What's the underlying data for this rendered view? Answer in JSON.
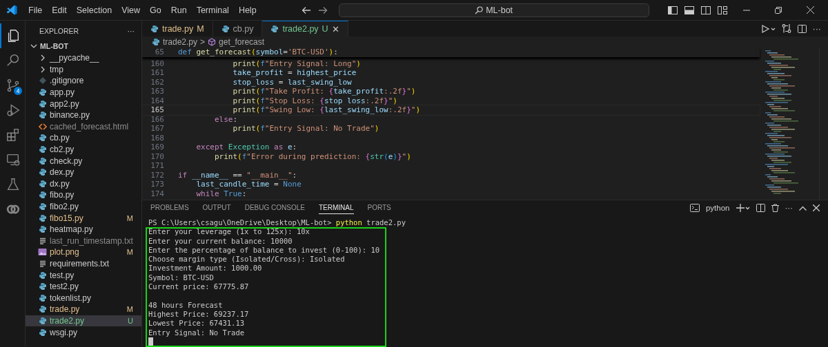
{
  "menu": [
    "File",
    "Edit",
    "Selection",
    "View",
    "Go",
    "Run",
    "Terminal",
    "Help"
  ],
  "command_center": {
    "text": "ML-bot"
  },
  "activity_bar": [
    {
      "kind": "explorer",
      "selected": true
    },
    {
      "kind": "search",
      "selected": false
    },
    {
      "kind": "source-control",
      "selected": false,
      "badge": "4"
    },
    {
      "kind": "run",
      "selected": false
    },
    {
      "kind": "extensions",
      "selected": false
    },
    {
      "kind": "remote",
      "selected": false
    },
    {
      "kind": "testing",
      "selected": false
    },
    {
      "kind": "copilot",
      "selected": false
    }
  ],
  "explorer": {
    "title": "EXPLORER",
    "more": "···",
    "folder": {
      "name": "ML-BOT",
      "expanded": true
    },
    "items": [
      {
        "name": "__pycache__",
        "kind": "folder",
        "expanded": false,
        "selected": false
      },
      {
        "name": "tmp",
        "kind": "folder",
        "expanded": false,
        "selected": false
      },
      {
        "name": ".gitignore",
        "kind": "ignore",
        "selected": false
      },
      {
        "name": "app.py",
        "kind": "python",
        "selected": false
      },
      {
        "name": "app2.py",
        "kind": "python",
        "selected": false
      },
      {
        "name": "binance.py",
        "kind": "python",
        "selected": false
      },
      {
        "name": "cached_forecast.html",
        "kind": "html",
        "ignored": true,
        "selected": false
      },
      {
        "name": "cb.py",
        "kind": "python",
        "selected": false
      },
      {
        "name": "cb2.py",
        "kind": "python",
        "selected": false
      },
      {
        "name": "check.py",
        "kind": "python",
        "selected": false
      },
      {
        "name": "dex.py",
        "kind": "python",
        "selected": false
      },
      {
        "name": "dx.py",
        "kind": "python",
        "selected": false
      },
      {
        "name": "fibo.py",
        "kind": "python",
        "selected": false
      },
      {
        "name": "fibo2.py",
        "kind": "python",
        "selected": false
      },
      {
        "name": "fibo15.py",
        "kind": "python",
        "status": "M",
        "selected": false
      },
      {
        "name": "heatmap.py",
        "kind": "python",
        "selected": false
      },
      {
        "name": "last_run_timestamp.txt",
        "kind": "text",
        "ignored": true,
        "selected": false
      },
      {
        "name": "plot.png",
        "kind": "image",
        "status": "M",
        "selected": false
      },
      {
        "name": "requirements.txt",
        "kind": "text",
        "selected": false
      },
      {
        "name": "test.py",
        "kind": "python",
        "selected": false
      },
      {
        "name": "test2.py",
        "kind": "python",
        "selected": false
      },
      {
        "name": "tokenlist.py",
        "kind": "python",
        "selected": false
      },
      {
        "name": "trade.py",
        "kind": "python",
        "status": "M",
        "selected": false
      },
      {
        "name": "trade2.py",
        "kind": "python",
        "status": "U",
        "selected": true
      },
      {
        "name": "wsgi.py",
        "kind": "python",
        "selected": false
      }
    ]
  },
  "tabs": [
    {
      "label": "trade.py",
      "status": "M",
      "selected": false
    },
    {
      "label": "cb.py",
      "selected": false
    },
    {
      "label": "trade2.py",
      "status": "U",
      "selected": true,
      "close": "✕"
    }
  ],
  "editor_actions": {
    "more": "···"
  },
  "breadcrumb": {
    "file": "trade2.py",
    "separator": ">",
    "symbol": "get_forecast"
  },
  "sticky_line": {
    "number": "65",
    "tokens": [
      {
        "kind": "storage",
        "text": "def "
      },
      {
        "kind": "fn",
        "text": "get_forecast"
      },
      {
        "kind": "brace1",
        "text": "("
      },
      {
        "kind": "var",
        "text": "symbol"
      },
      {
        "kind": "op",
        "text": "="
      },
      {
        "kind": "str",
        "text": "'BTC-USD'"
      },
      {
        "kind": "brace1",
        "text": ")"
      },
      {
        "kind": "plain",
        "text": ":"
      }
    ]
  },
  "code_lines": [
    {
      "number": "160",
      "current": false,
      "tokens": [
        {
          "kind": "fn",
          "text": "            print"
        },
        {
          "kind": "brace1",
          "text": "("
        },
        {
          "kind": "storage",
          "text": "f"
        },
        {
          "kind": "str",
          "text": "\"Entry Signal: Long\""
        },
        {
          "kind": "brace1",
          "text": ")"
        }
      ]
    },
    {
      "number": "161",
      "current": false,
      "tokens": [
        {
          "kind": "var",
          "text": "            take_profit"
        },
        {
          "kind": "op",
          "text": " = "
        },
        {
          "kind": "var",
          "text": "highest_price"
        }
      ]
    },
    {
      "number": "162",
      "current": false,
      "tokens": [
        {
          "kind": "var",
          "text": "            stop_loss"
        },
        {
          "kind": "op",
          "text": " = "
        },
        {
          "kind": "var",
          "text": "last_swing_low"
        }
      ]
    },
    {
      "number": "163",
      "current": false,
      "tokens": [
        {
          "kind": "fn",
          "text": "            print"
        },
        {
          "kind": "brace1",
          "text": "("
        },
        {
          "kind": "storage",
          "text": "f"
        },
        {
          "kind": "str",
          "text": "\"Take Profit: "
        },
        {
          "kind": "brace2",
          "text": "{"
        },
        {
          "kind": "var",
          "text": "take_profit"
        },
        {
          "kind": "str",
          "text": ":.2f"
        },
        {
          "kind": "brace2",
          "text": "}"
        },
        {
          "kind": "str",
          "text": "\""
        },
        {
          "kind": "brace1",
          "text": ")"
        }
      ]
    },
    {
      "number": "164",
      "current": false,
      "tokens": [
        {
          "kind": "fn",
          "text": "            print"
        },
        {
          "kind": "brace1",
          "text": "("
        },
        {
          "kind": "storage",
          "text": "f"
        },
        {
          "kind": "str",
          "text": "\"Stop Loss: "
        },
        {
          "kind": "brace2",
          "text": "{"
        },
        {
          "kind": "var",
          "text": "stop_loss"
        },
        {
          "kind": "str",
          "text": ":.2f"
        },
        {
          "kind": "brace2",
          "text": "}"
        },
        {
          "kind": "str",
          "text": "\""
        },
        {
          "kind": "brace1",
          "text": ")"
        }
      ]
    },
    {
      "number": "165",
      "current": true,
      "tokens": [
        {
          "kind": "fn",
          "text": "            print"
        },
        {
          "kind": "brace1",
          "text": "("
        },
        {
          "kind": "storage",
          "text": "f"
        },
        {
          "kind": "str",
          "text": "\"Swing Low: "
        },
        {
          "kind": "brace2",
          "text": "{"
        },
        {
          "kind": "var",
          "text": "last_swing_low"
        },
        {
          "kind": "str",
          "text": ":.2f"
        },
        {
          "kind": "brace2",
          "text": "}"
        },
        {
          "kind": "str",
          "text": "\""
        },
        {
          "kind": "brace1",
          "text": ")"
        }
      ]
    },
    {
      "number": "166",
      "current": false,
      "tokens": [
        {
          "kind": "control",
          "text": "        else"
        },
        {
          "kind": "plain",
          "text": ":"
        }
      ]
    },
    {
      "number": "167",
      "current": false,
      "tokens": [
        {
          "kind": "fn",
          "text": "            print"
        },
        {
          "kind": "brace1",
          "text": "("
        },
        {
          "kind": "storage",
          "text": "f"
        },
        {
          "kind": "str",
          "text": "\"Entry Signal: No Trade\""
        },
        {
          "kind": "brace1",
          "text": ")"
        }
      ]
    },
    {
      "number": "168",
      "current": false
    },
    {
      "number": "169",
      "current": false,
      "tokens": [
        {
          "kind": "control",
          "text": "    except "
        },
        {
          "kind": "class",
          "text": "Exception "
        },
        {
          "kind": "control",
          "text": "as "
        },
        {
          "kind": "var",
          "text": "e"
        },
        {
          "kind": "plain",
          "text": ":"
        }
      ]
    },
    {
      "number": "170",
      "current": false,
      "tokens": [
        {
          "kind": "fn",
          "text": "        print"
        },
        {
          "kind": "brace1",
          "text": "("
        },
        {
          "kind": "storage",
          "text": "f"
        },
        {
          "kind": "str",
          "text": "\"Error during prediction: "
        },
        {
          "kind": "brace2",
          "text": "{"
        },
        {
          "kind": "class",
          "text": "str"
        },
        {
          "kind": "brace3",
          "text": "("
        },
        {
          "kind": "var",
          "text": "e"
        },
        {
          "kind": "brace3",
          "text": ")"
        },
        {
          "kind": "brace2",
          "text": "}"
        },
        {
          "kind": "str",
          "text": "\""
        },
        {
          "kind": "brace1",
          "text": ")"
        }
      ]
    },
    {
      "number": "171",
      "current": false
    },
    {
      "number": "172",
      "current": false,
      "tokens": [
        {
          "kind": "control",
          "text": "if "
        },
        {
          "kind": "var",
          "text": "__name__"
        },
        {
          "kind": "op",
          "text": " == "
        },
        {
          "kind": "str",
          "text": "\"__main__\""
        },
        {
          "kind": "plain",
          "text": ":"
        }
      ]
    },
    {
      "number": "173",
      "current": false,
      "tokens": [
        {
          "kind": "var",
          "text": "    last_candle_time"
        },
        {
          "kind": "op",
          "text": " = "
        },
        {
          "kind": "storage",
          "text": "None"
        }
      ]
    },
    {
      "number": "174",
      "current": false,
      "tokens": [
        {
          "kind": "control",
          "text": "    while "
        },
        {
          "kind": "storage",
          "text": "True"
        },
        {
          "kind": "plain",
          "text": ":"
        }
      ]
    }
  ],
  "panel": {
    "tabs": [
      {
        "label": "PROBLEMS",
        "selected": false
      },
      {
        "label": "OUTPUT",
        "selected": false
      },
      {
        "label": "DEBUG CONSOLE",
        "selected": false
      },
      {
        "label": "TERMINAL",
        "selected": true
      },
      {
        "label": "PORTS",
        "selected": false
      }
    ],
    "shell": "python",
    "more": "···",
    "terminal": {
      "prompt": "PS C:\\Users\\csagu\\OneDrive\\Desktop\\ML-bot>",
      "command": "python",
      "args": "trade2.py",
      "blocks": [
        [
          "Enter your leverage (1x to 125x): 10x",
          "Enter your current balance: 10000",
          "Enter the percentage of balance to invest (0-100): 10",
          "Choose margin type (Isolated/Cross): Isolated",
          "Investment Amount: 1000.00",
          "Symbol: BTC-USD",
          "Current price: 67775.87"
        ],
        [
          "48 hours Forecast",
          "Highest Price: 69237.17",
          "Lowest Price: 67431.13",
          "Entry Signal: No Trade"
        ]
      ]
    }
  }
}
